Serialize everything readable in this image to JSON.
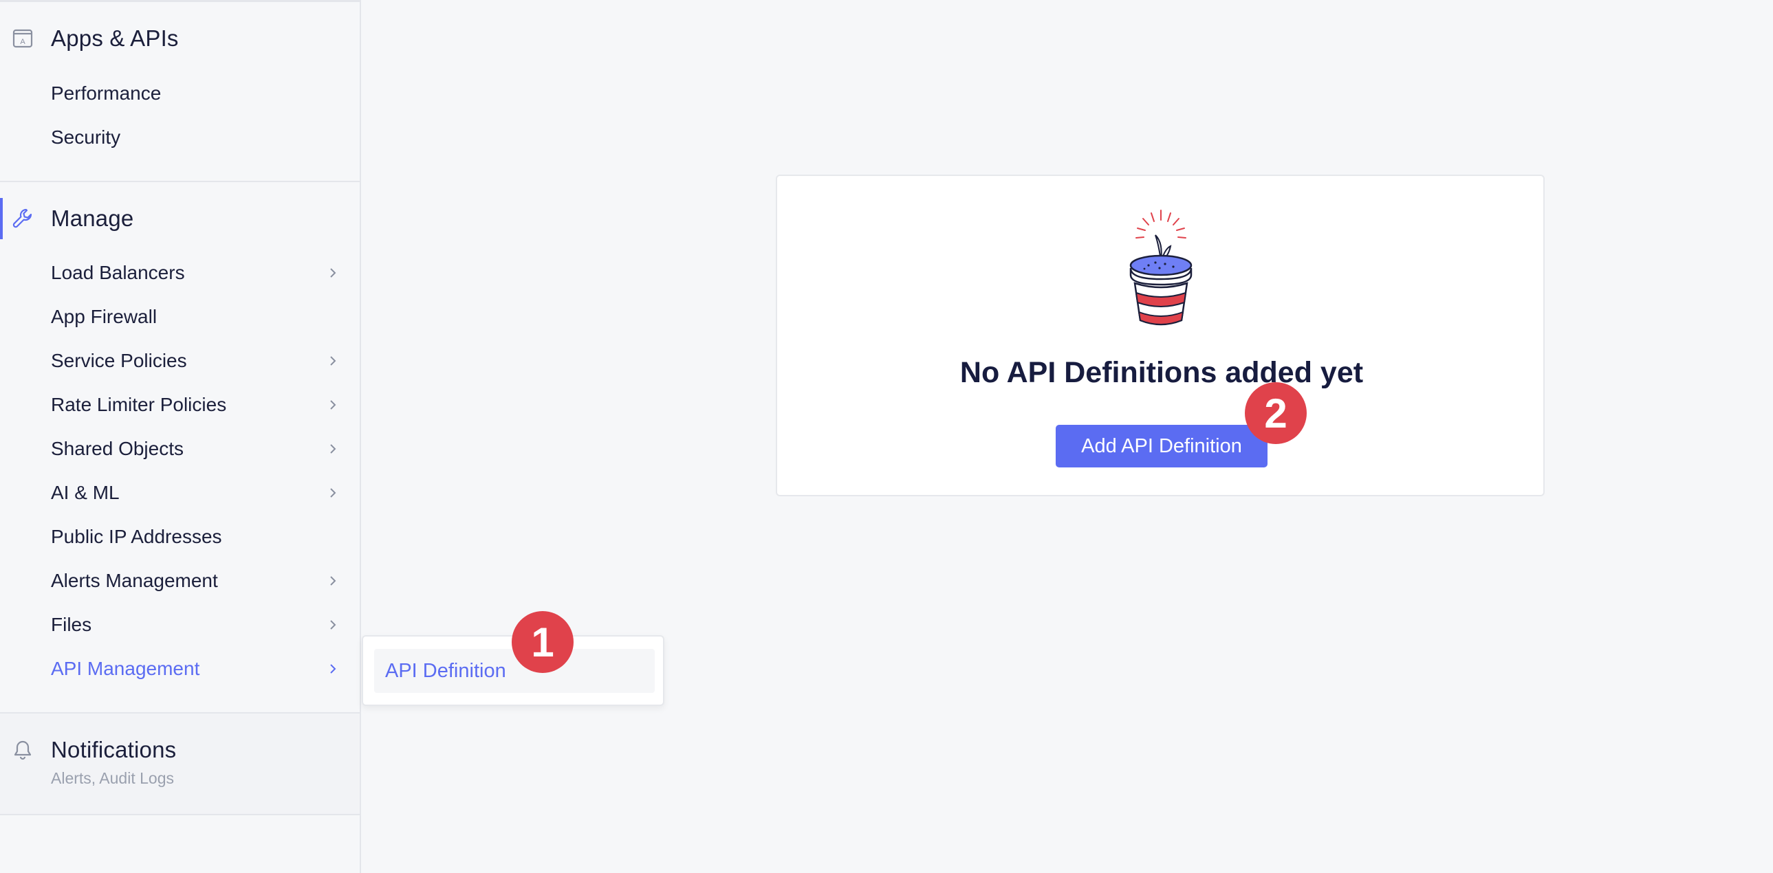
{
  "sidebar": {
    "apps_section": {
      "title": "Apps & APIs",
      "icon": "app-box-icon",
      "items": [
        {
          "label": "Performance"
        },
        {
          "label": "Security"
        }
      ]
    },
    "manage_section": {
      "title": "Manage",
      "icon": "wrench-icon",
      "items": [
        {
          "label": "Load Balancers",
          "has_submenu": true
        },
        {
          "label": "App Firewall",
          "has_submenu": false
        },
        {
          "label": "Service Policies",
          "has_submenu": true
        },
        {
          "label": "Rate Limiter Policies",
          "has_submenu": true
        },
        {
          "label": "Shared Objects",
          "has_submenu": true
        },
        {
          "label": "AI & ML",
          "has_submenu": true
        },
        {
          "label": "Public IP Addresses",
          "has_submenu": false
        },
        {
          "label": "Alerts Management",
          "has_submenu": true
        },
        {
          "label": "Files",
          "has_submenu": true
        },
        {
          "label": "API Management",
          "has_submenu": true,
          "active": true
        }
      ]
    },
    "notifications_section": {
      "title": "Notifications",
      "subtitle": "Alerts, Audit Logs",
      "icon": "bell-icon"
    }
  },
  "flyout": {
    "items": [
      {
        "label": "API Definition"
      }
    ]
  },
  "empty_state": {
    "title": "No API Definitions added yet",
    "button_label": "Add API Definition",
    "illustration": "plant-pot-icon"
  },
  "step_badges": [
    {
      "number": "1"
    },
    {
      "number": "2"
    }
  ],
  "colors": {
    "accent": "#5b6cf2",
    "badge": "#e0424b",
    "background": "#f6f7f9",
    "text": "#1b1f3b"
  }
}
